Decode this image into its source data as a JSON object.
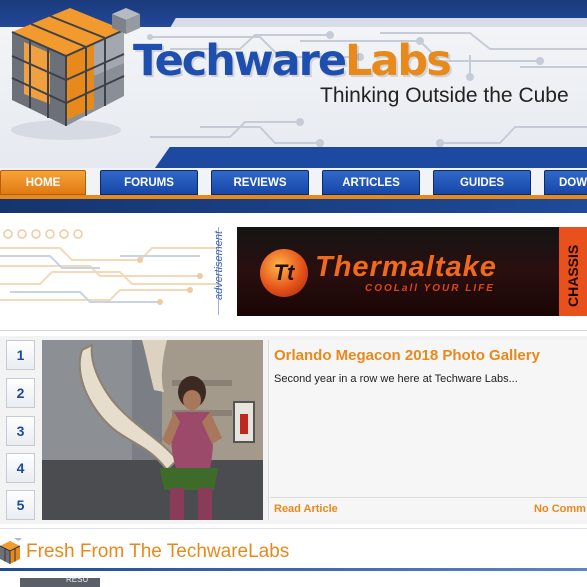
{
  "site": {
    "logo_word_1": "Techware",
    "logo_word_2": "Labs",
    "tagline": "Thinking Outside the Cube"
  },
  "nav": {
    "items": [
      {
        "label": "HOME",
        "active": true
      },
      {
        "label": "FORUMS",
        "active": false
      },
      {
        "label": "REVIEWS",
        "active": false
      },
      {
        "label": "ARTICLES",
        "active": false
      },
      {
        "label": "GUIDES",
        "active": false
      },
      {
        "label": "DOWN",
        "active": false
      }
    ]
  },
  "ad": {
    "label": "advertisement",
    "brand": "Thermaltake",
    "logo_letters": "Tt",
    "slogan": "COOLall YOUR LIFE",
    "side_text": "CHASSIS"
  },
  "featured": {
    "slides": [
      "1",
      "2",
      "3",
      "4",
      "5"
    ],
    "title": "Orlando Megacon 2018 Photo Gallery",
    "excerpt": "Second year in a row we here at Techware Labs...",
    "read_label": "Read Article",
    "comments_label": "No Comm"
  },
  "fresh": {
    "title": "Fresh From The TechwareLabs",
    "thumb_text": "RESU"
  },
  "colors": {
    "brand_blue": "#1e4fae",
    "brand_orange": "#e8891c",
    "nav_blue": "#1647a8"
  },
  "icons": {
    "logo": "cube-logo-icon",
    "fresh": "cube-small-icon"
  }
}
